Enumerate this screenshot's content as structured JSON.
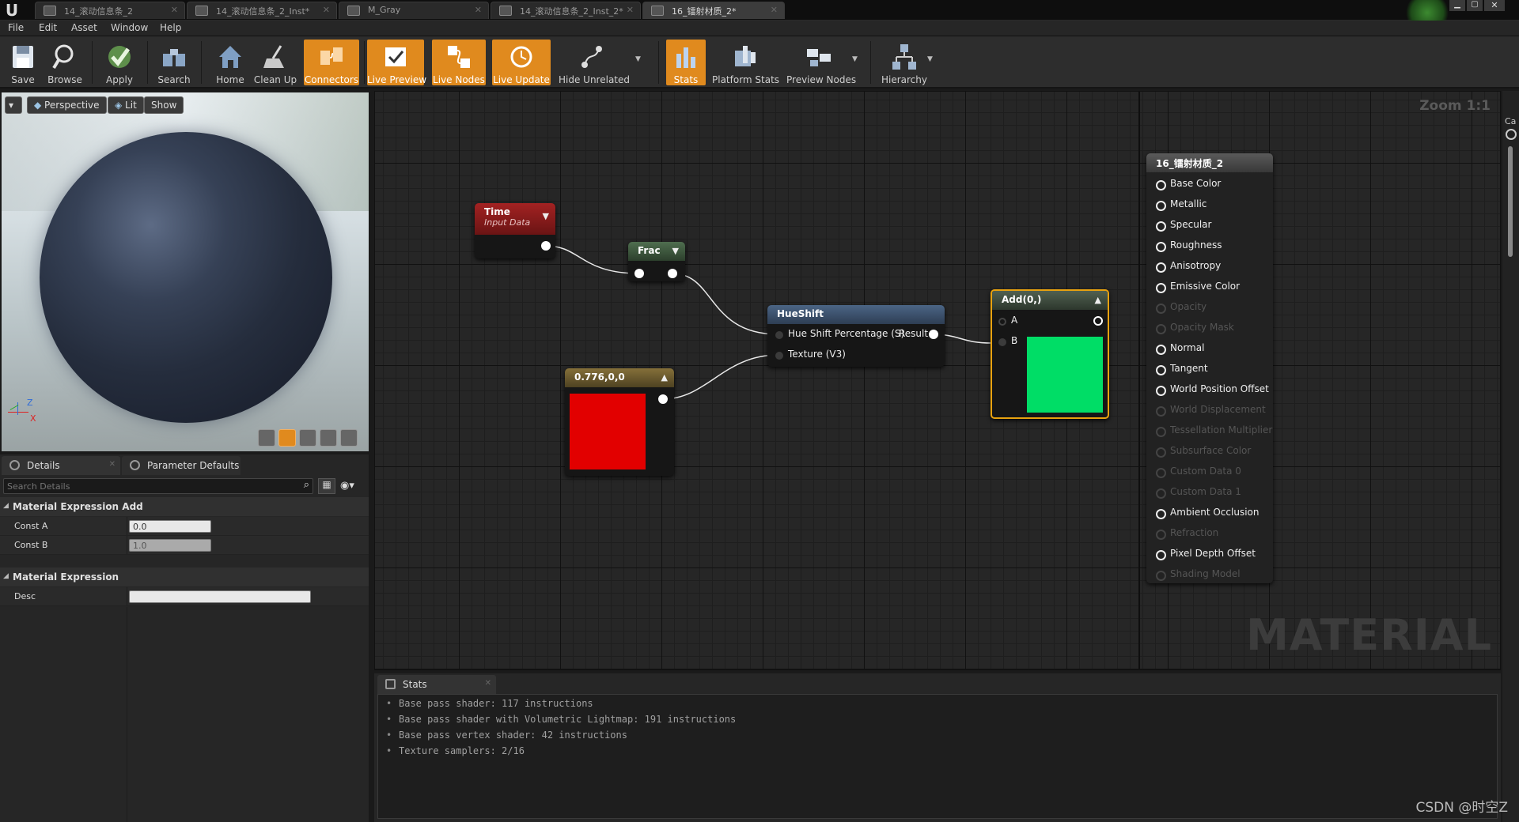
{
  "tabs": [
    {
      "label": "14_滚动信息条_2"
    },
    {
      "label": "14_滚动信息条_2_Inst*"
    },
    {
      "label": "M_Gray"
    },
    {
      "label": "14_滚动信息条_2_Inst_2*"
    },
    {
      "label": "16_镭射材质_2*"
    }
  ],
  "menu": {
    "file": "File",
    "edit": "Edit",
    "asset": "Asset",
    "window": "Window",
    "help": "Help"
  },
  "toolbar": {
    "save": "Save",
    "browse": "Browse",
    "apply": "Apply",
    "search": "Search",
    "home": "Home",
    "cleanup": "Clean Up",
    "connectors": "Connectors",
    "live_preview": "Live Preview",
    "live_nodes": "Live Nodes",
    "live_update": "Live Update",
    "hide_unrelated": "Hide Unrelated",
    "stats": "Stats",
    "platform_stats": "Platform Stats",
    "preview_nodes": "Preview Nodes",
    "hierarchy": "Hierarchy",
    "accent_color": "#e08a1e"
  },
  "viewport": {
    "perspective": "Perspective",
    "lit": "Lit",
    "show": "Show",
    "axis_z": "Z",
    "axis_x": "X"
  },
  "details": {
    "tab_details": "Details",
    "tab_params": "Parameter Defaults",
    "search_placeholder": "Search Details",
    "section_add": "Material Expression Add",
    "const_a_label": "Const A",
    "const_a_value": "0.0",
    "const_b_label": "Const B",
    "const_b_value": "1.0",
    "section_expr": "Material Expression",
    "desc_label": "Desc",
    "desc_value": ""
  },
  "graph": {
    "zoom": "Zoom 1:1",
    "watermark": "MATERIAL",
    "nodes": {
      "time": {
        "title": "Time",
        "subtitle": "Input Data",
        "color": "#8a1d1d"
      },
      "frac": {
        "title": "Frac",
        "color": "#3f5a3f"
      },
      "hueshift": {
        "title": "HueShift",
        "pin_a": "Hue Shift Percentage (S)",
        "pin_b": "Texture (V3)",
        "output": "Result",
        "color": "#3c5068"
      },
      "constant": {
        "title": "0.776,0,0",
        "swatch": "#e20000",
        "color": "#6b5a28"
      },
      "add": {
        "title": "Add(0,)",
        "pin_a": "A",
        "pin_b": "B",
        "swatch": "#00dd66",
        "color": "#3f4a3f",
        "border": "#e8a20f"
      },
      "result": {
        "title": "16_镭射材质_2",
        "color": "#4a4a4a"
      }
    },
    "result_pins": [
      {
        "label": "Base Color",
        "enabled": true
      },
      {
        "label": "Metallic",
        "enabled": true
      },
      {
        "label": "Specular",
        "enabled": true
      },
      {
        "label": "Roughness",
        "enabled": true
      },
      {
        "label": "Anisotropy",
        "enabled": true
      },
      {
        "label": "Emissive Color",
        "enabled": true
      },
      {
        "label": "Opacity",
        "enabled": false
      },
      {
        "label": "Opacity Mask",
        "enabled": false
      },
      {
        "label": "Normal",
        "enabled": true
      },
      {
        "label": "Tangent",
        "enabled": true
      },
      {
        "label": "World Position Offset",
        "enabled": true
      },
      {
        "label": "World Displacement",
        "enabled": false
      },
      {
        "label": "Tessellation Multiplier",
        "enabled": false
      },
      {
        "label": "Subsurface Color",
        "enabled": false
      },
      {
        "label": "Custom Data 0",
        "enabled": false
      },
      {
        "label": "Custom Data 1",
        "enabled": false
      },
      {
        "label": "Ambient Occlusion",
        "enabled": true
      },
      {
        "label": "Refraction",
        "enabled": false
      },
      {
        "label": "Pixel Depth Offset",
        "enabled": true
      },
      {
        "label": "Shading Model",
        "enabled": false
      }
    ]
  },
  "stats": {
    "tab": "Stats",
    "lines": [
      "Base pass shader: 117 instructions",
      "Base pass shader with Volumetric Lightmap: 191 instructions",
      "Base pass vertex shader: 42 instructions",
      "Texture samplers: 2/16"
    ]
  },
  "watermark": "CSDN @时空Z",
  "right_strip_label": "Ca"
}
